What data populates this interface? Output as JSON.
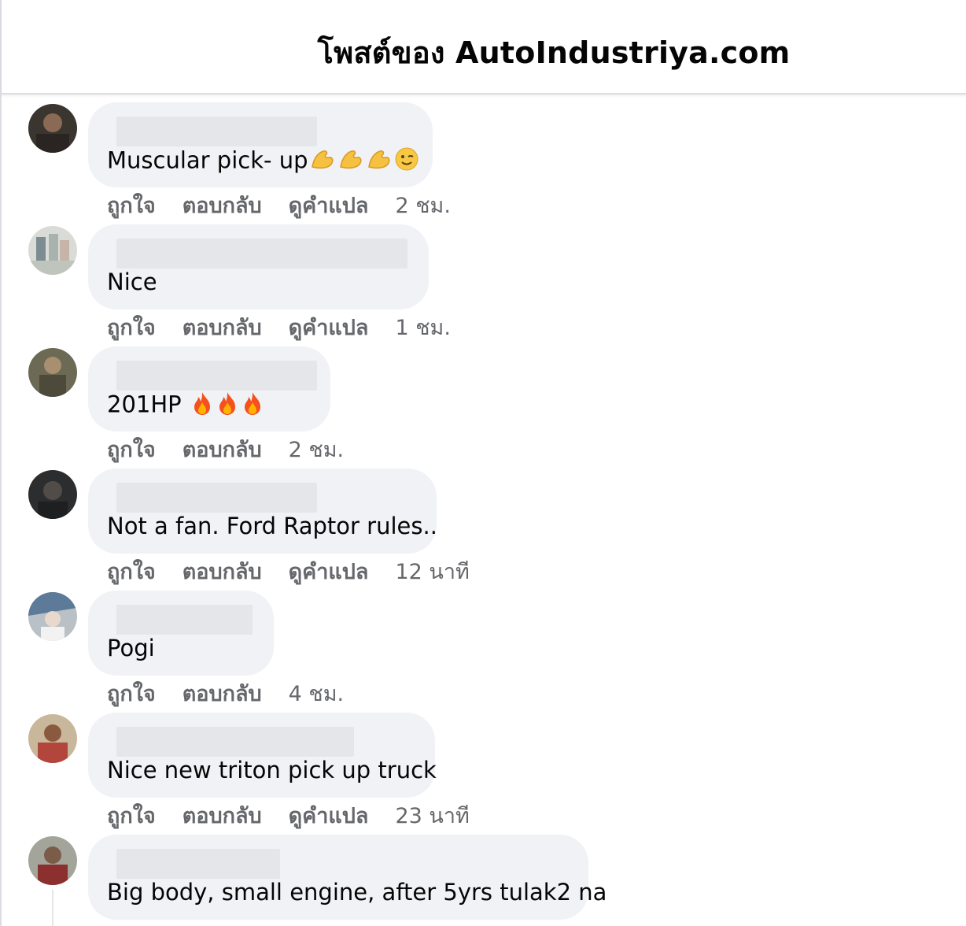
{
  "header": {
    "title": "โพสต์ของ AutoIndustriya.com"
  },
  "comments": [
    {
      "text": "Muscular pick- up",
      "emoji": [
        "flexed-biceps-icon",
        "flexed-biceps-icon",
        "flexed-biceps-icon",
        "winking-face-icon"
      ],
      "actions": {
        "like": "ถูกใจ",
        "reply": "ตอบกลับ",
        "translate": "ดูคำแปล"
      },
      "time": "2 ชม."
    },
    {
      "text": "Nice",
      "emoji": [],
      "actions": {
        "like": "ถูกใจ",
        "reply": "ตอบกลับ",
        "translate": "ดูคำแปล"
      },
      "time": "1 ชม."
    },
    {
      "text": "201HP",
      "emoji": [
        "fire-icon",
        "fire-icon",
        "fire-icon"
      ],
      "actions": {
        "like": "ถูกใจ",
        "reply": "ตอบกลับ"
      },
      "time": "2 ชม."
    },
    {
      "text": "Not a fan. Ford Raptor rules..",
      "emoji": [],
      "actions": {
        "like": "ถูกใจ",
        "reply": "ตอบกลับ",
        "translate": "ดูคำแปล"
      },
      "time": "12 นาที"
    },
    {
      "text": "Pogi",
      "emoji": [],
      "actions": {
        "like": "ถูกใจ",
        "reply": "ตอบกลับ"
      },
      "time": "4 ชม."
    },
    {
      "text": "Nice new triton pick up truck",
      "emoji": [],
      "actions": {
        "like": "ถูกใจ",
        "reply": "ตอบกลับ",
        "translate": "ดูคำแปล"
      },
      "time": "23 นาที"
    },
    {
      "text": "Big body, small engine, after 5yrs tulak2 na",
      "emoji": [],
      "actions": {},
      "time": ""
    }
  ],
  "colors": {
    "bubble": "#f0f2f5",
    "secondary_text": "#65676b",
    "primary_text": "#050505",
    "divider": "#dadde1"
  }
}
